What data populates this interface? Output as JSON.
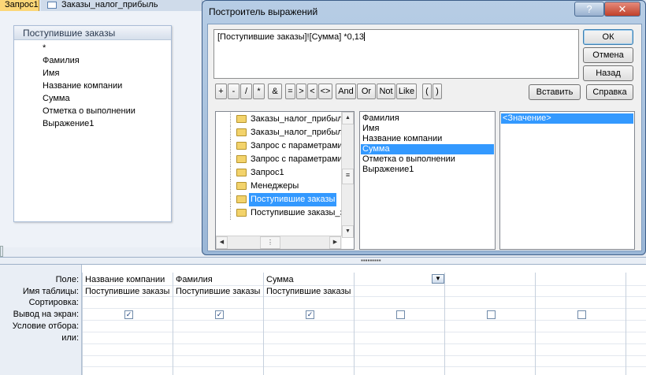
{
  "tabs": [
    {
      "label": "Запрос1"
    },
    {
      "label": "Заказы_налог_прибыль"
    }
  ],
  "table_box": {
    "title": "Поступившие заказы",
    "fields": [
      "*",
      "Фамилия",
      "Имя",
      "Название компании",
      "Сумма",
      "Отметка о выполнении",
      "Выражение1"
    ]
  },
  "grid": {
    "row_labels": [
      "Поле:",
      "Имя таблицы:",
      "Сортировка:",
      "Вывод на экран:",
      "Условие отбора:",
      "или:"
    ],
    "columns": [
      {
        "field": "Название компании",
        "table": "Поступившие заказы",
        "show": true
      },
      {
        "field": "Фамилия",
        "table": "Поступившие заказы",
        "show": true
      },
      {
        "field": "Сумма",
        "table": "Поступившие заказы",
        "show": true
      },
      {
        "field": "",
        "table": "",
        "show": false
      },
      {
        "field": "",
        "table": "",
        "show": false
      },
      {
        "field": "",
        "table": "",
        "show": false
      }
    ],
    "show_checkmark": "✓"
  },
  "dialog": {
    "title": "Построитель выражений",
    "help_glyph": "?",
    "close_glyph": "✕",
    "expression": "[Поступившие заказы]![Сумма] *0,13",
    "buttons": {
      "ok": "ОК",
      "cancel": "Отмена",
      "back": "Назад",
      "insert": "Вставить",
      "help": "Справка"
    },
    "operators": [
      "+",
      "-",
      "/",
      "*",
      "&",
      "=",
      ">",
      "<",
      "<>",
      "And",
      "Or",
      "Not",
      "Like",
      "(",
      ")"
    ],
    "tree": [
      {
        "label": "Заказы_налог_прибыль",
        "selected": false,
        "open": false
      },
      {
        "label": "Заказы_налог_прибыль",
        "selected": false,
        "open": false
      },
      {
        "label": "Запрос с параметрами",
        "selected": false,
        "open": false
      },
      {
        "label": "Запрос с параметрами",
        "selected": false,
        "open": false
      },
      {
        "label": "Запрос1",
        "selected": false,
        "open": false
      },
      {
        "label": "Менеджеры",
        "selected": false,
        "open": false
      },
      {
        "label": "Поступившие заказы",
        "selected": true,
        "open": true
      },
      {
        "label": "Поступившие заказы_з",
        "selected": false,
        "open": false
      }
    ],
    "fields_list": [
      {
        "label": "Фамилия",
        "selected": false
      },
      {
        "label": "Имя",
        "selected": false
      },
      {
        "label": "Название компании",
        "selected": false
      },
      {
        "label": "Сумма",
        "selected": true
      },
      {
        "label": "Отметка о выполнении",
        "selected": false
      },
      {
        "label": "Выражение1",
        "selected": false
      }
    ],
    "values_list": [
      {
        "label": "<Значение>",
        "selected": true
      }
    ]
  },
  "colors": {
    "selection": "#3399ff",
    "active_tab": "#fbd778",
    "close_button": "#c0412b"
  }
}
